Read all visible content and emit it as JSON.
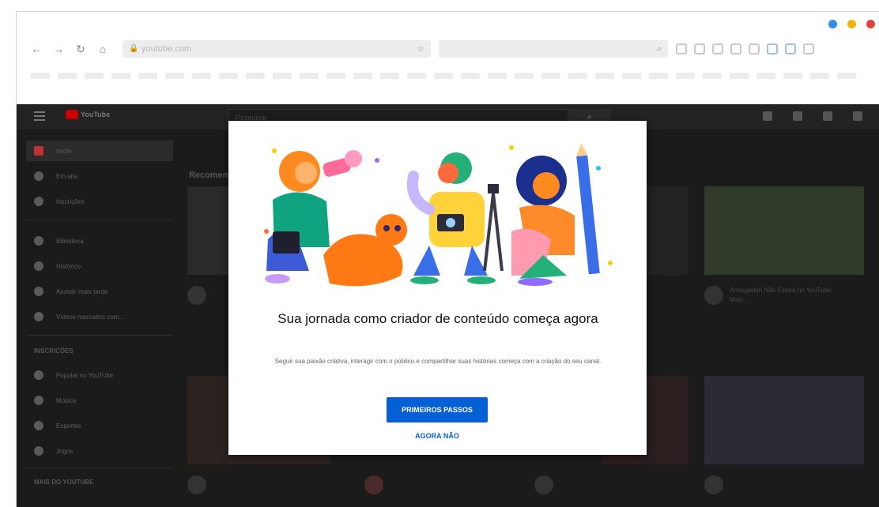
{
  "browser": {
    "window_dots": [
      "#2f8de4",
      "#f1b400",
      "#e0443a"
    ],
    "url": "youtube.com",
    "toolbar_icon_names": [
      "reload-icon",
      "home-icon"
    ]
  },
  "youtube": {
    "search_placeholder": "Pesquisar",
    "section_title": "Recomendados",
    "sidebar": {
      "items": [
        {
          "label": "Início"
        },
        {
          "label": "Em alta"
        },
        {
          "label": "Inscrições"
        },
        {
          "label": "Biblioteca"
        },
        {
          "label": "Histórico"
        },
        {
          "label": "Assistir mais tarde"
        },
        {
          "label": "Vídeos marcados com..."
        }
      ],
      "subscriptions_heading": "INSCRIÇÕES",
      "subscriptions": [
        {
          "label": "Popular no YouTube"
        },
        {
          "label": "Música"
        },
        {
          "label": "Esportes"
        },
        {
          "label": "Jogos"
        }
      ],
      "more_heading": "MAIS DO YOUTUBE"
    },
    "videos_right_top": {
      "title": "Armagedon Não Estará no YouTube Mais..."
    }
  },
  "modal": {
    "title": "Sua jornada como criador de conteúdo começa agora",
    "subtitle": "Seguir sua paixão criativa, interagir com o público e compartilhar suas histórias começa com a criação do seu canal.",
    "primary_button": "PRIMEIROS PASSOS",
    "secondary_link": "AGORA NÃO"
  },
  "colors": {
    "accent": "#065fd4",
    "yt_red": "#cc0000"
  }
}
